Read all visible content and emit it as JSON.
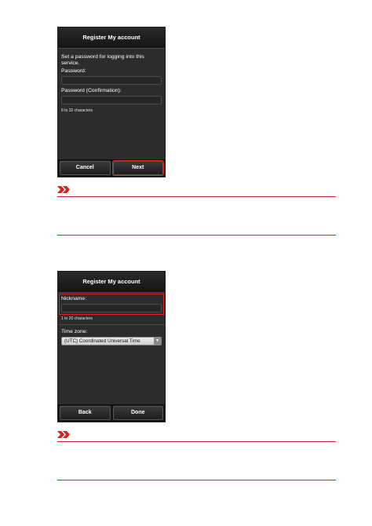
{
  "screen1": {
    "title": "Register My account",
    "instruction": "Set a password for logging into this service.",
    "password_label": "Password:",
    "password_confirm_label": "Password (Confirmation):",
    "hint": "8 to 32 characters",
    "cancel_label": "Cancel",
    "next_label": "Next"
  },
  "screen2": {
    "title": "Register My account",
    "nickname_label": "Nickname:",
    "hint": "1 to 20 characters",
    "timezone_label": "Time zone:",
    "timezone_value": "(UTC) Coordinated Universal Time",
    "back_label": "Back",
    "done_label": "Done"
  },
  "icons": {
    "note_icon": "important-chevrons-icon"
  },
  "colors": {
    "accent": "#e0201a",
    "screen_bg": "#2c2c2c"
  }
}
